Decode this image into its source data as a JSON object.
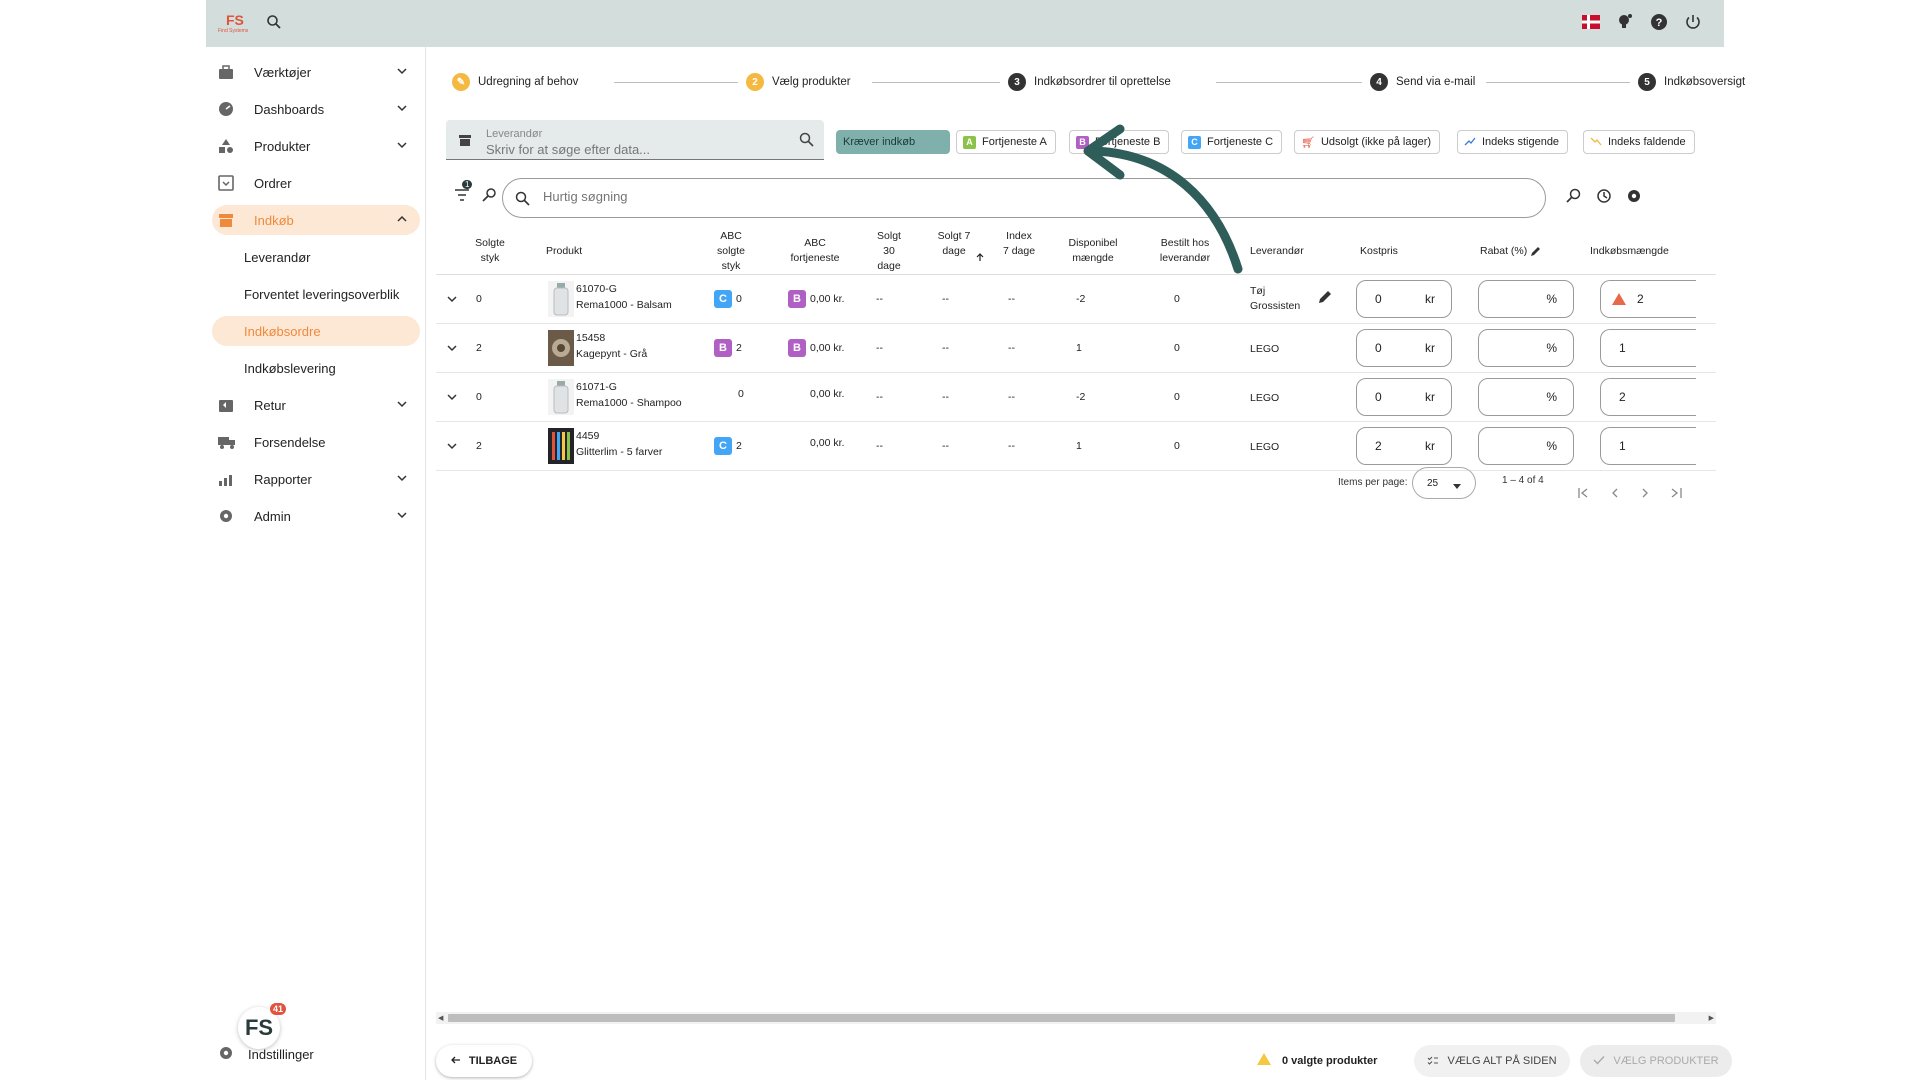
{
  "topbar": {
    "logo_text": "FS",
    "logo_tagline": "Find Systems",
    "icons": [
      "search-icon",
      "danish-flag-icon",
      "lightbulb-icon",
      "help-icon",
      "power-icon"
    ]
  },
  "sidebar": {
    "items": [
      {
        "label": "Værktøjer",
        "icon": "toolbox-icon",
        "expandable": true
      },
      {
        "label": "Dashboards",
        "icon": "gauge-icon",
        "expandable": true
      },
      {
        "label": "Produkter",
        "icon": "shapes-icon",
        "expandable": true
      },
      {
        "label": "Ordrer",
        "icon": "inbox-icon",
        "expandable": false
      },
      {
        "label": "Indkøb",
        "icon": "store-icon",
        "expandable": true,
        "active": true
      }
    ],
    "sub_items": [
      {
        "label": "Leverandør"
      },
      {
        "label": "Forventet leveringsoverblik"
      },
      {
        "label": "Indkøbsordre",
        "active": true
      },
      {
        "label": "Indkøbslevering"
      }
    ],
    "items_after": [
      {
        "label": "Retur",
        "icon": "return-icon",
        "expandable": true
      },
      {
        "label": "Forsendelse",
        "icon": "truck-icon",
        "expandable": false
      },
      {
        "label": "Rapporter",
        "icon": "chart-icon",
        "expandable": true
      },
      {
        "label": "Admin",
        "icon": "admin-gear-icon",
        "expandable": true
      }
    ],
    "badge_text": "FS",
    "badge_count": "41",
    "settings_label": "Indstillinger"
  },
  "stepper": [
    {
      "n": "✎",
      "label": "Udregning af behov",
      "state": "done"
    },
    {
      "n": "2",
      "label": "Vælg produkter",
      "state": "current"
    },
    {
      "n": "3",
      "label": "Indkøbsordrer til oprettelse",
      "state": "todo"
    },
    {
      "n": "4",
      "label": "Send via e-mail",
      "state": "todo"
    },
    {
      "n": "5",
      "label": "Indkøbsoversigt",
      "state": "todo"
    }
  ],
  "supplier": {
    "label": "Leverandør",
    "placeholder": "Skriv for at søge efter data..."
  },
  "chips": [
    {
      "label": "Kræver indkøb",
      "type": "teal"
    },
    {
      "label": "Fortjeneste A",
      "letter": "A",
      "color": "#8bc34a"
    },
    {
      "label": "Fortjeneste B",
      "letter": "B",
      "color": "#b05fc4"
    },
    {
      "label": "Fortjeneste C",
      "letter": "C",
      "color": "#42a5f5"
    },
    {
      "label": "Udsolgt (ikke på lager)"
    },
    {
      "label": "Indeks stigende"
    },
    {
      "label": "Indeks faldende"
    }
  ],
  "filter_count": "1",
  "quick_search": {
    "placeholder": "Hurtig søgning"
  },
  "table": {
    "headers": {
      "sold": "Solgte styk",
      "product": "Produkt",
      "abc_sold": "ABC solgte styk",
      "abc_profit": "ABC fortjeneste",
      "sold30": "Solgt 30 dage",
      "sold7": "Solgt 7 dage",
      "index7": "Index 7 dage",
      "available": "Disponibel mængde",
      "ordered": "Bestilt hos leverandør",
      "supplier": "Leverandør",
      "cost": "Kostpris",
      "discount": "Rabat (%)",
      "purchase_qty": "Indkøbsmængde"
    },
    "rows": [
      {
        "sold": "0",
        "sku": "61070-G",
        "name": "Rema1000 - Balsam",
        "thumb": "bottle",
        "abc_sold_letter": "C",
        "abc_sold_color": "#42a5f5",
        "abc_sold_val": "0",
        "abc_profit_letter": "B",
        "abc_profit_color": "#b05fc4",
        "abc_profit_val": "0,00 kr.",
        "sold30": "--",
        "sold7": "--",
        "index7": "--",
        "available": "-2",
        "ordered": "0",
        "supplier": "Tøj Grossisten",
        "cost": "0",
        "cost_unit": "kr",
        "discount": "",
        "discount_unit": "%",
        "qty": "2",
        "qty_warning": true
      },
      {
        "sold": "2",
        "sku": "15458",
        "name": "Kagepynt - Grå",
        "thumb": "ornament",
        "abc_sold_letter": "B",
        "abc_sold_color": "#b05fc4",
        "abc_sold_val": "2",
        "abc_profit_letter": "B",
        "abc_profit_color": "#b05fc4",
        "abc_profit_val": "0,00 kr.",
        "sold30": "--",
        "sold7": "--",
        "index7": "--",
        "available": "1",
        "ordered": "0",
        "supplier": "LEGO",
        "cost": "0",
        "cost_unit": "kr",
        "discount": "",
        "discount_unit": "%",
        "qty": "1",
        "qty_warning": false
      },
      {
        "sold": "0",
        "sku": "61071-G",
        "name": "Rema1000 - Shampoo",
        "thumb": "bottle",
        "abc_sold_letter": "",
        "abc_sold_color": "",
        "abc_sold_val": "0",
        "abc_profit_letter": "",
        "abc_profit_color": "",
        "abc_profit_val": "0,00 kr.",
        "sold30": "--",
        "sold7": "--",
        "index7": "--",
        "available": "-2",
        "ordered": "0",
        "supplier": "LEGO",
        "cost": "0",
        "cost_unit": "kr",
        "discount": "",
        "discount_unit": "%",
        "qty": "2",
        "qty_warning": false
      },
      {
        "sold": "2",
        "sku": "4459",
        "name": "Glitterlim - 5 farver",
        "thumb": "glitter",
        "abc_sold_letter": "C",
        "abc_sold_color": "#42a5f5",
        "abc_sold_val": "2",
        "abc_profit_letter": "",
        "abc_profit_color": "",
        "abc_profit_val": "0,00 kr.",
        "sold30": "--",
        "sold7": "--",
        "index7": "--",
        "available": "1",
        "ordered": "0",
        "supplier": "LEGO",
        "cost": "2",
        "cost_unit": "kr",
        "discount": "",
        "discount_unit": "%",
        "qty": "1",
        "qty_warning": false
      }
    ]
  },
  "pagination": {
    "items_per_page_label": "Items per page:",
    "items_per_page": "25",
    "range": "1 – 4 of 4"
  },
  "footer": {
    "back_label": "TILBAGE",
    "selected_label": "0 valgte produkter",
    "select_all_label": "VÆLG ALT PÅ SIDEN",
    "choose_label": "VÆLG PRODUKTER"
  },
  "colors": {
    "accent": "#ef8a3c",
    "accent_bg": "#fde8d6",
    "topbar": "#d3dedc",
    "teal_arrow": "#2f5d5a"
  }
}
